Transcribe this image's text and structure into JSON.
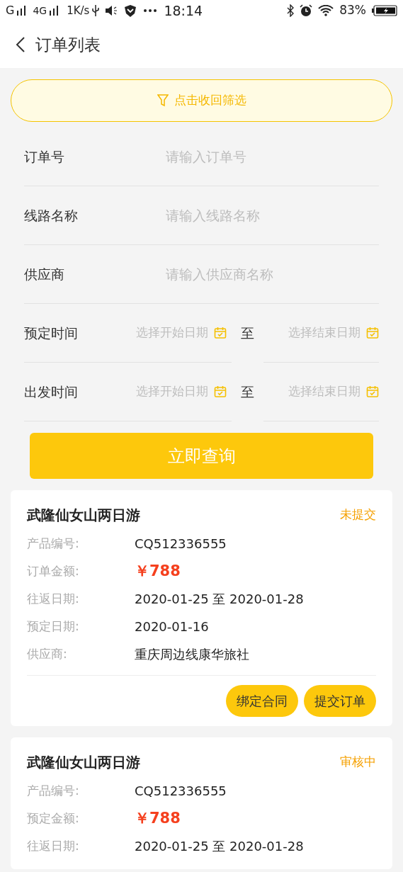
{
  "status_bar": {
    "network_1": "G",
    "network_2": "4G",
    "speed": "1K/s",
    "time": "18:14",
    "battery": "83%"
  },
  "header": {
    "title": "订单列表"
  },
  "filter_toggle": {
    "label": "点击收回筛选"
  },
  "form": {
    "fields": [
      {
        "kind": "text",
        "label": "订单号",
        "placeholder": "请输入订单号"
      },
      {
        "kind": "text",
        "label": "线路名称",
        "placeholder": "请输入线路名称"
      },
      {
        "kind": "text",
        "label": "供应商",
        "placeholder": "请输入供应商名称"
      },
      {
        "kind": "range",
        "label": "预定时间",
        "start_placeholder": "选择开始日期",
        "separator": "至",
        "end_placeholder": "选择结束日期"
      },
      {
        "kind": "range",
        "label": "出发时间",
        "start_placeholder": "选择开始日期",
        "separator": "至",
        "end_placeholder": "选择结束日期"
      }
    ],
    "submit": "立即查询"
  },
  "orders": [
    {
      "title": "武隆仙女山两日游",
      "status": "未提交",
      "rows": [
        {
          "kind": "text",
          "label": "产品编号:",
          "value": "CQ512336555"
        },
        {
          "kind": "price",
          "label": "订单金额:",
          "value": "￥788"
        },
        {
          "kind": "text",
          "label": "往返日期:",
          "value": "2020-01-25 至 2020-01-28"
        },
        {
          "kind": "text",
          "label": "预定日期:",
          "value": "2020-01-16"
        },
        {
          "kind": "text",
          "label": "供应商:",
          "value": "重庆周边线康华旅社"
        }
      ],
      "actions": [
        "绑定合同",
        "提交订单"
      ]
    },
    {
      "title": "武隆仙女山两日游",
      "status": "审核中",
      "rows": [
        {
          "kind": "text",
          "label": "产品编号:",
          "value": "CQ512336555"
        },
        {
          "kind": "price",
          "label": "预定金额:",
          "value": "￥788"
        },
        {
          "kind": "text",
          "label": "往返日期:",
          "value": "2020-01-25 至 2020-01-28"
        }
      ]
    }
  ]
}
